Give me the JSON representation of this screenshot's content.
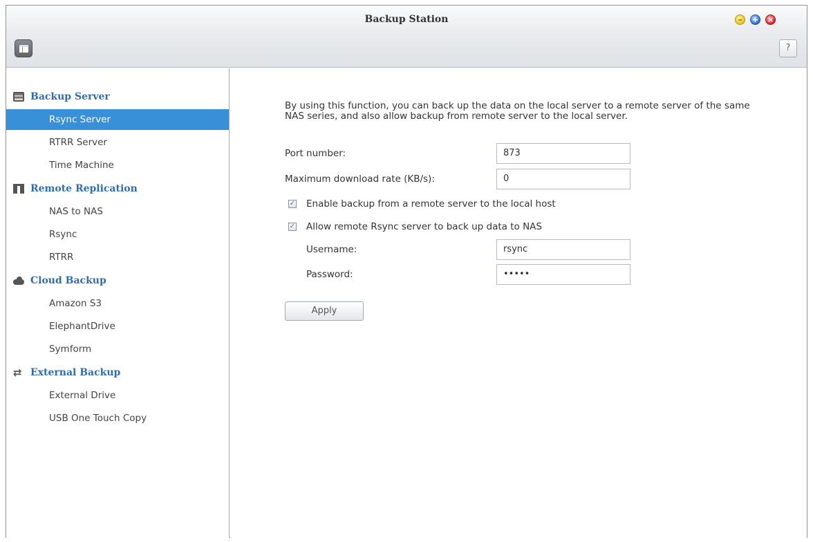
{
  "window": {
    "title": "Backup Station"
  },
  "toolbar": {
    "help_label": "?"
  },
  "sidebar": {
    "groups": [
      {
        "label": "Backup Server",
        "icon": "server-icon",
        "items": [
          "Rsync Server",
          "RTRR Server",
          "Time Machine"
        ]
      },
      {
        "label": "Remote Replication",
        "icon": "replication-icon",
        "items": [
          "NAS to NAS",
          "Rsync",
          "RTRR"
        ]
      },
      {
        "label": "Cloud Backup",
        "icon": "cloud-icon",
        "items": [
          "Amazon S3",
          "ElephantDrive",
          "Symform"
        ]
      },
      {
        "label": "External Backup",
        "icon": "sync-icon",
        "items": [
          "External Drive",
          "USB One Touch Copy"
        ]
      }
    ],
    "selected": "Rsync Server"
  },
  "form": {
    "description": "By using this function, you can back up the data on the local server to a remote server of the same NAS series, and also allow backup from remote server to the local server.",
    "port_label": "Port number:",
    "port_value": "873",
    "rate_label": "Maximum download rate (KB/s):",
    "rate_value": "0",
    "enable_backup_label": "Enable backup from a remote server to the local host",
    "enable_backup_checked": true,
    "allow_rsync_label": "Allow remote Rsync server to back up data to NAS",
    "allow_rsync_checked": true,
    "username_label": "Username:",
    "username_value": "rsync",
    "password_label": "Password:",
    "password_value": "•••••",
    "apply_label": "Apply"
  },
  "colors": {
    "accent": "#3790d8",
    "group_heading": "#2e6db4"
  }
}
